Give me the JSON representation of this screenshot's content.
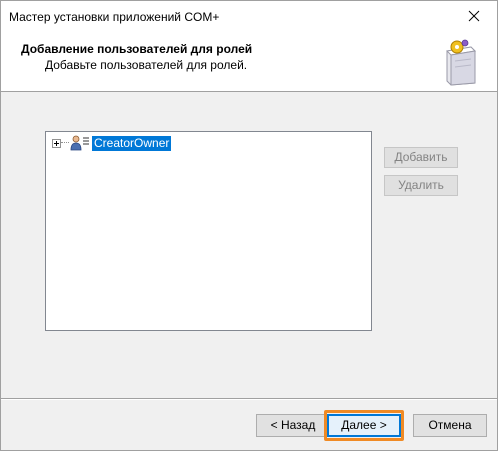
{
  "window": {
    "title": "Мастер установки приложений COM+"
  },
  "header": {
    "title": "Добавление пользователей для ролей",
    "subtitle": "Добавьте пользователей для ролей."
  },
  "tree": {
    "items": [
      {
        "label": "CreatorOwner",
        "selected": true,
        "expandable": true
      }
    ]
  },
  "side_buttons": {
    "add_label": "Добавить",
    "remove_label": "Удалить"
  },
  "footer": {
    "back_label": "< Назад",
    "next_label": "Далее >",
    "cancel_label": "Отмена"
  },
  "colors": {
    "selection": "#0078d7",
    "highlight_frame": "#f08a24"
  },
  "icons": {
    "close": "close-icon",
    "wizard": "wizard-box-icon",
    "user_group": "user-group-icon"
  }
}
